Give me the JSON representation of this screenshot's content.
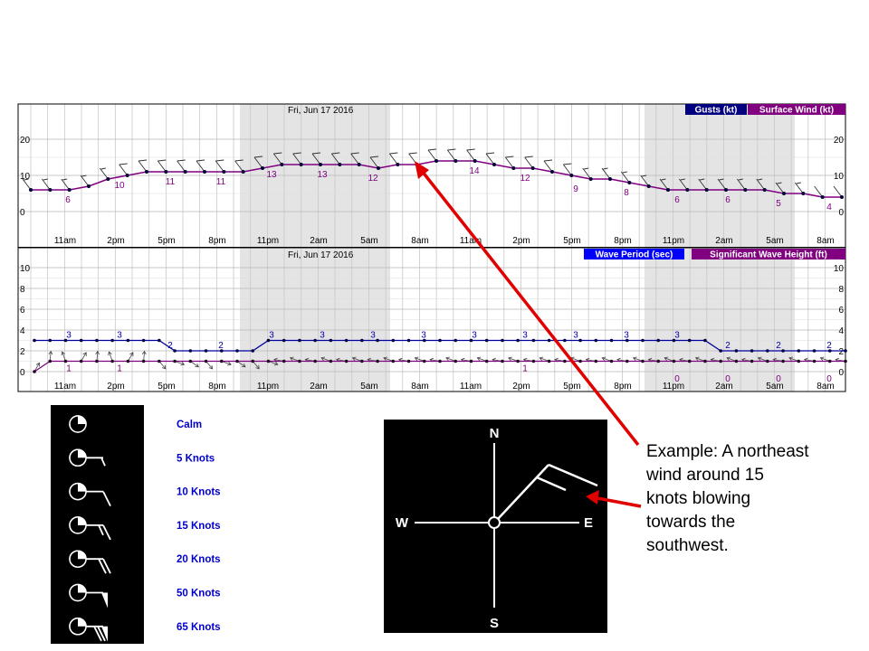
{
  "chart_data": [
    {
      "type": "line",
      "name": "top-panel",
      "date_label": "Fri, Jun 17 2016",
      "legend": [
        "Gusts (kt)",
        "Surface Wind (kt)"
      ],
      "legend_colors": [
        "#000080",
        "#800080"
      ],
      "y_ticks": [
        0,
        10,
        20
      ],
      "ylim": [
        -1,
        25
      ],
      "x_tick_labels": [
        "11am",
        "2pm",
        "5pm",
        "8pm",
        "11pm",
        "2am",
        "5am",
        "8am",
        "11am",
        "2pm",
        "5pm",
        "8pm",
        "11pm",
        "2am",
        "5am",
        "8am"
      ],
      "series": [
        {
          "name": "Surface Wind (kt)",
          "color": "#800080",
          "values": [
            6,
            6,
            6,
            7,
            9,
            10,
            11,
            11,
            11,
            11,
            11,
            11,
            12,
            13,
            13,
            13,
            13,
            13,
            12,
            13,
            13,
            14,
            14,
            14,
            13,
            12,
            12,
            11,
            10,
            9,
            9,
            8,
            7,
            6,
            6,
            6,
            6,
            6,
            6,
            5,
            5,
            4,
            4
          ]
        }
      ],
      "data_labels": [
        {
          "index": 2,
          "text": "6"
        },
        {
          "index": 5,
          "text": "10"
        },
        {
          "index": 8,
          "text": "11"
        },
        {
          "index": 11,
          "text": "11"
        },
        {
          "index": 14,
          "text": "13"
        },
        {
          "index": 17,
          "text": "13"
        },
        {
          "index": 20,
          "text": "12"
        },
        {
          "index": 26,
          "text": "14"
        },
        {
          "index": 29,
          "text": "12"
        },
        {
          "index": 32,
          "text": "9"
        },
        {
          "index": 35,
          "text": "8"
        },
        {
          "index": 38,
          "text": "6"
        },
        {
          "index": 41,
          "text": "6"
        },
        {
          "index": 44,
          "text": "5"
        },
        {
          "index": 47,
          "text": "4"
        }
      ]
    },
    {
      "type": "line",
      "name": "bottom-panel",
      "date_label": "Fri, Jun 17 2016",
      "legend": [
        "Wave Period (sec)",
        "Significant Wave Height (ft)"
      ],
      "legend_colors": [
        "#0000ff",
        "#800080"
      ],
      "y_ticks": [
        0,
        2,
        4,
        6,
        8,
        10
      ],
      "ylim": [
        -0.5,
        11
      ],
      "x_tick_labels": [
        "11am",
        "2pm",
        "5pm",
        "8pm",
        "11pm",
        "2am",
        "5am",
        "8am",
        "11am",
        "2pm",
        "5pm",
        "8pm",
        "11pm",
        "2am",
        "5am",
        "8am"
      ],
      "series": [
        {
          "name": "Wave Period (sec)",
          "color": "#0000a0",
          "values": [
            3,
            3,
            3,
            3,
            3,
            3,
            3,
            3,
            3,
            2,
            2,
            2,
            2,
            2,
            2,
            3,
            3,
            3,
            3,
            3,
            3,
            3,
            3,
            3,
            3,
            3,
            3,
            3,
            3,
            3,
            3,
            3,
            3,
            3,
            3,
            3,
            3,
            3,
            3,
            3,
            3,
            3,
            3,
            3,
            2,
            2,
            2,
            2,
            2,
            2,
            2,
            2,
            2
          ]
        },
        {
          "name": "Significant Wave Height (ft)",
          "color": "#800080",
          "values": [
            0,
            1,
            1,
            1,
            1,
            1,
            1,
            1,
            1,
            1,
            1,
            1,
            1,
            1,
            1,
            1,
            1,
            1,
            1,
            1,
            1,
            1,
            1,
            1,
            1,
            1,
            1,
            1,
            1,
            1,
            1,
            1,
            1,
            1,
            1,
            1,
            1,
            1,
            1,
            1,
            1,
            1,
            1,
            1,
            1,
            1,
            1,
            1,
            1,
            1,
            1,
            1,
            1
          ]
        }
      ],
      "period_labels": [
        {
          "x": 76,
          "text": "3"
        },
        {
          "x": 132,
          "text": "3"
        },
        {
          "x": 188,
          "text": "2"
        },
        {
          "x": 244,
          "text": "2"
        },
        {
          "x": 300,
          "text": "3"
        },
        {
          "x": 356,
          "text": "3"
        },
        {
          "x": 412,
          "text": "3"
        },
        {
          "x": 468,
          "text": "3"
        },
        {
          "x": 524,
          "text": "3"
        },
        {
          "x": 580,
          "text": "3"
        },
        {
          "x": 636,
          "text": "3"
        },
        {
          "x": 692,
          "text": "3"
        },
        {
          "x": 748,
          "text": "3"
        },
        {
          "x": 804,
          "text": "2"
        },
        {
          "x": 860,
          "text": "2"
        },
        {
          "x": 916,
          "text": "2"
        }
      ],
      "height_labels": [
        {
          "x": 76,
          "text": "1"
        },
        {
          "x": 132,
          "text": "1"
        },
        {
          "x": 580,
          "text": "1"
        },
        {
          "x": 748,
          "text": "0"
        },
        {
          "x": 804,
          "text": "0"
        },
        {
          "x": 860,
          "text": "0"
        },
        {
          "x": 916,
          "text": "0"
        }
      ]
    }
  ],
  "barb_legend": {
    "items": [
      "Calm",
      "5 Knots",
      "10 Knots",
      "15 Knots",
      "20 Knots",
      "50 Knots",
      "65 Knots"
    ]
  },
  "compass": {
    "n": "N",
    "s": "S",
    "e": "E",
    "w": "W"
  },
  "annotation": {
    "lines": [
      "Example: A northeast",
      "wind around 15",
      "knots blowing",
      "towards the",
      "southwest."
    ]
  },
  "colors": {
    "night_shade": "#e4e4e4",
    "grid": "#c8c8c8",
    "arrow": "#e00000",
    "legend_text": "#0000cc"
  }
}
